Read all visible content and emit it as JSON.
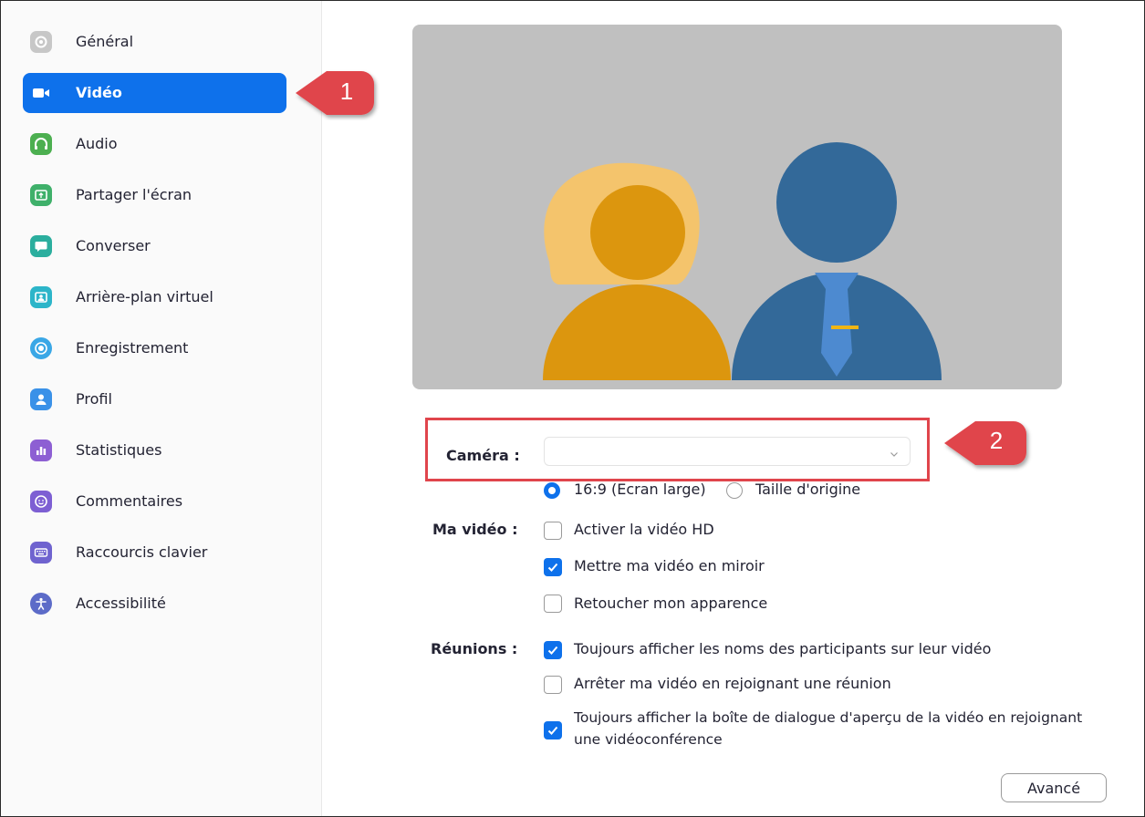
{
  "sidebar": {
    "items": [
      {
        "label": "Général",
        "icon": "gear-icon",
        "color": "#c7c7c7"
      },
      {
        "label": "Vidéo",
        "icon": "video-camera-icon",
        "color": "#0e71eb",
        "active": true
      },
      {
        "label": "Audio",
        "icon": "headphones-icon",
        "color": "#4caf50"
      },
      {
        "label": "Partager l'écran",
        "icon": "share-screen-icon",
        "color": "#3fb06a"
      },
      {
        "label": "Converser",
        "icon": "chat-icon",
        "color": "#2bae9e"
      },
      {
        "label": "Arrière-plan virtuel",
        "icon": "virtual-background-icon",
        "color": "#2cb5c9"
      },
      {
        "label": "Enregistrement",
        "icon": "record-icon",
        "color": "#3aa7e6"
      },
      {
        "label": "Profil",
        "icon": "profile-icon",
        "color": "#3a91e8"
      },
      {
        "label": "Statistiques",
        "icon": "statistics-icon",
        "color": "#8d5fd3"
      },
      {
        "label": "Commentaires",
        "icon": "feedback-icon",
        "color": "#7d5fd3"
      },
      {
        "label": "Raccourcis clavier",
        "icon": "keyboard-icon",
        "color": "#6f63cf"
      },
      {
        "label": "Accessibilité",
        "icon": "accessibility-icon",
        "color": "#5c6bc8"
      }
    ]
  },
  "callouts": {
    "one": "1",
    "two": "2"
  },
  "form": {
    "camera_label": "Caméra :",
    "camera_value": "",
    "aspect": {
      "wide": "16:9 (Ecran large)",
      "original": "Taille d'origine",
      "selected": "wide"
    },
    "my_video_label": "Ma vidéo :",
    "my_video": [
      {
        "label": "Activer la vidéo HD",
        "checked": false
      },
      {
        "label": "Mettre ma vidéo en miroir",
        "checked": true
      },
      {
        "label": "Retoucher mon apparence",
        "checked": false
      }
    ],
    "meetings_label": "Réunions :",
    "meetings": [
      {
        "label": "Toujours afficher les noms des participants sur leur vidéo",
        "checked": true
      },
      {
        "label": "Arrêter ma vidéo en rejoignant une réunion",
        "checked": false
      },
      {
        "label_line1": "Toujours afficher la boîte de dialogue d'aperçu de la vidéo en rejoignant",
        "label_line2": "une vidéoconférence",
        "checked": true
      }
    ],
    "advanced_button": "Avancé"
  },
  "colors": {
    "accent": "#0e71eb",
    "callout": "#e0454c",
    "preview_bg": "#c0c0c0",
    "woman": "#dc960e",
    "woman_hair": "#f4c46c",
    "man": "#336999",
    "tie": "#4d8ad0",
    "tie_bar": "#f0b515"
  }
}
